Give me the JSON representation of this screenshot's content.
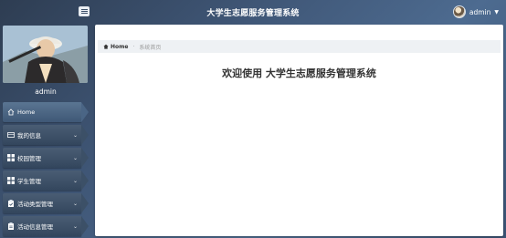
{
  "header": {
    "title": "大学生志愿服务管理系统",
    "username": "admin"
  },
  "sidebar": {
    "profile_name": "admin",
    "items": [
      {
        "label": "Home",
        "icon": "home-icon"
      },
      {
        "label": "我的信息",
        "icon": "id-card-icon"
      },
      {
        "label": "校园管理",
        "icon": "grid-icon"
      },
      {
        "label": "学生管理",
        "icon": "grid-icon"
      },
      {
        "label": "活动类型管理",
        "icon": "clipboard-icon"
      },
      {
        "label": "活动信息管理",
        "icon": "clipboard-icon"
      }
    ]
  },
  "breadcrumb": {
    "home": "Home",
    "current": "系统首页"
  },
  "main": {
    "welcome": "欢迎使用 大学生志愿服务管理系统"
  }
}
